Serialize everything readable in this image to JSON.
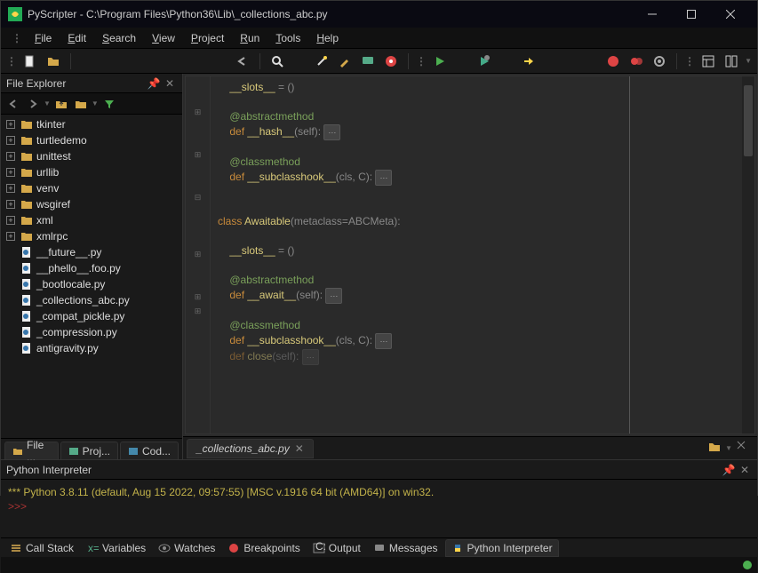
{
  "titlebar": {
    "app_name": "PyScripter",
    "file_path": "C:\\Program Files\\Python36\\Lib\\_collections_abc.py"
  },
  "menu": {
    "file": "File",
    "edit": "Edit",
    "search": "Search",
    "view": "View",
    "project": "Project",
    "run": "Run",
    "tools": "Tools",
    "help": "Help"
  },
  "file_explorer": {
    "title": "File Explorer",
    "items": [
      {
        "type": "folder",
        "label": "tkinter"
      },
      {
        "type": "folder",
        "label": "turtledemo"
      },
      {
        "type": "folder",
        "label": "unittest"
      },
      {
        "type": "folder",
        "label": "urllib"
      },
      {
        "type": "folder",
        "label": "venv"
      },
      {
        "type": "folder",
        "label": "wsgiref"
      },
      {
        "type": "folder",
        "label": "xml"
      },
      {
        "type": "folder",
        "label": "xmlrpc"
      },
      {
        "type": "py",
        "label": "__future__.py"
      },
      {
        "type": "py",
        "label": "__phello__.foo.py"
      },
      {
        "type": "py",
        "label": "_bootlocale.py"
      },
      {
        "type": "py",
        "label": "_collections_abc.py"
      },
      {
        "type": "py",
        "label": "_compat_pickle.py"
      },
      {
        "type": "py",
        "label": "_compression.py"
      },
      {
        "type": "py",
        "label": "antigravity.py"
      }
    ]
  },
  "sidebar_tabs": {
    "file": "File ...",
    "project": "Proj...",
    "code": "Cod..."
  },
  "editor": {
    "tab_label": "_collections_abc.py",
    "code": {
      "l1a": "__slots__",
      "l1b": " = ()",
      "l3": "@abstractmethod",
      "l4a": "def ",
      "l4b": "__hash__",
      "l4c": "(self): ",
      "l6": "@classmethod",
      "l7a": "def ",
      "l7b": "__subclasshook__",
      "l7c": "(cls, C): ",
      "l9a": "class ",
      "l9b": "Awaitable",
      "l9c": "(metaclass=ABCMeta):",
      "l11a": "__slots__",
      "l11b": " = ()",
      "l13": "@abstractmethod",
      "l14a": "def ",
      "l14b": "__await__",
      "l14c": "(self): ",
      "l16": "@classmethod",
      "l17a": "def ",
      "l17b": "__subclasshook__",
      "l17c": "(cls, C): ",
      "l18a": "def ",
      "l18b": "close",
      "l18c": "(self): "
    }
  },
  "interpreter": {
    "title": "Python Interpreter",
    "banner": "*** Python 3.8.11 (default, Aug 15 2022, 09:57:55) [MSC v.1916 64 bit (AMD64)] on win32.",
    "prompt": ">>>"
  },
  "bottom_tabs": {
    "call_stack": "Call Stack",
    "variables": "Variables",
    "watches": "Watches",
    "breakpoints": "Breakpoints",
    "output": "Output",
    "messages": "Messages",
    "python_interpreter": "Python Interpreter"
  },
  "colors": {
    "status_dot": "#4caf50"
  }
}
